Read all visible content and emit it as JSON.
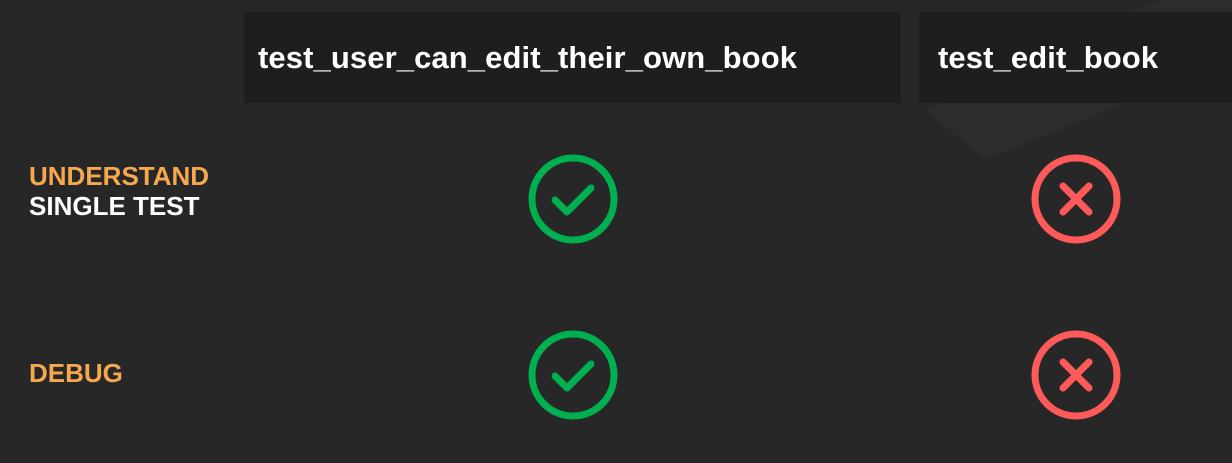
{
  "columns": [
    {
      "label": "test_user_can_edit_their_own_book"
    },
    {
      "label": "test_edit_book"
    }
  ],
  "rows": [
    {
      "label_highlight": "UNDERSTAND",
      "label_rest": "SINGLE TEST",
      "results": [
        "pass",
        "fail"
      ]
    },
    {
      "label_highlight": "DEBUG",
      "label_rest": "",
      "results": [
        "pass",
        "fail"
      ]
    }
  ],
  "icons": {
    "pass": "check-circle-icon",
    "fail": "x-circle-icon"
  },
  "colors": {
    "background": "#272727",
    "header_bg": "#1e1e1e",
    "highlight": "#f7a84e",
    "pass": "#00b050",
    "fail": "#ff5a5a"
  }
}
